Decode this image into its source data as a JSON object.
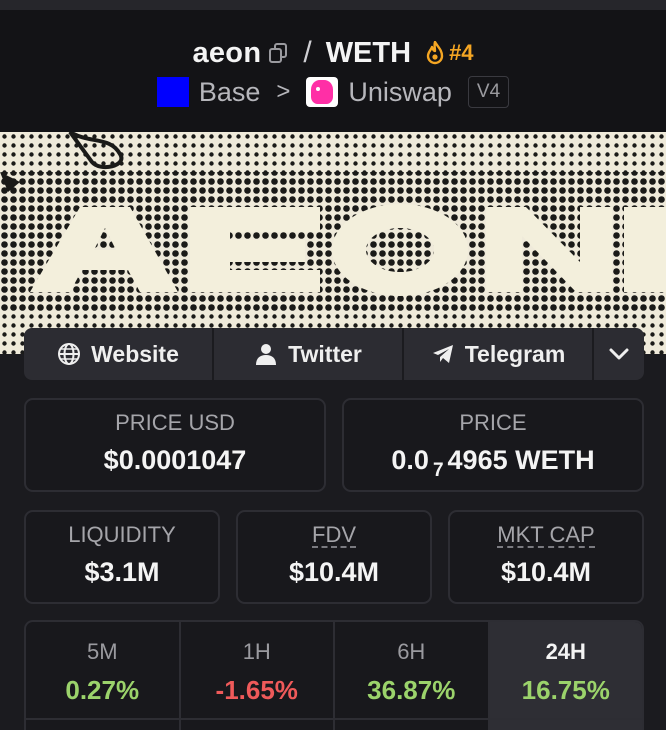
{
  "header": {
    "base_symbol": "aeon",
    "separator": "/",
    "quote_symbol": "WETH",
    "rank": "#4",
    "chain": "Base",
    "chain_color": "#0000ff",
    "breadcrumb_sep": ">",
    "dex": "Uniswap",
    "dex_version": "V4",
    "rank_color": "#f5a623"
  },
  "banner": {
    "text": "AEON"
  },
  "socials": {
    "website": "Website",
    "twitter": "Twitter",
    "telegram": "Telegram",
    "more_icon": "chevron-down-icon"
  },
  "stats": {
    "price_usd_label": "PRICE USD",
    "price_usd": "$0.0001047",
    "price_label": "PRICE",
    "price_prefix": "0.0",
    "price_zero_count": "7",
    "price_digits": "4965 WETH",
    "liquidity_label": "LIQUIDITY",
    "liquidity": "$3.1M",
    "fdv_label": "FDV",
    "fdv": "$10.4M",
    "mktcap_label": "MKT CAP",
    "mktcap": "$10.4M"
  },
  "timeframes": [
    {
      "label": "5M",
      "value": "0.27%",
      "color": "#9bd36b"
    },
    {
      "label": "1H",
      "value": "-1.65%",
      "color": "#ef5a5a"
    },
    {
      "label": "6H",
      "value": "36.87%",
      "color": "#9bd36b"
    },
    {
      "label": "24H",
      "value": "16.75%",
      "color": "#9bd36b",
      "active": true
    }
  ]
}
